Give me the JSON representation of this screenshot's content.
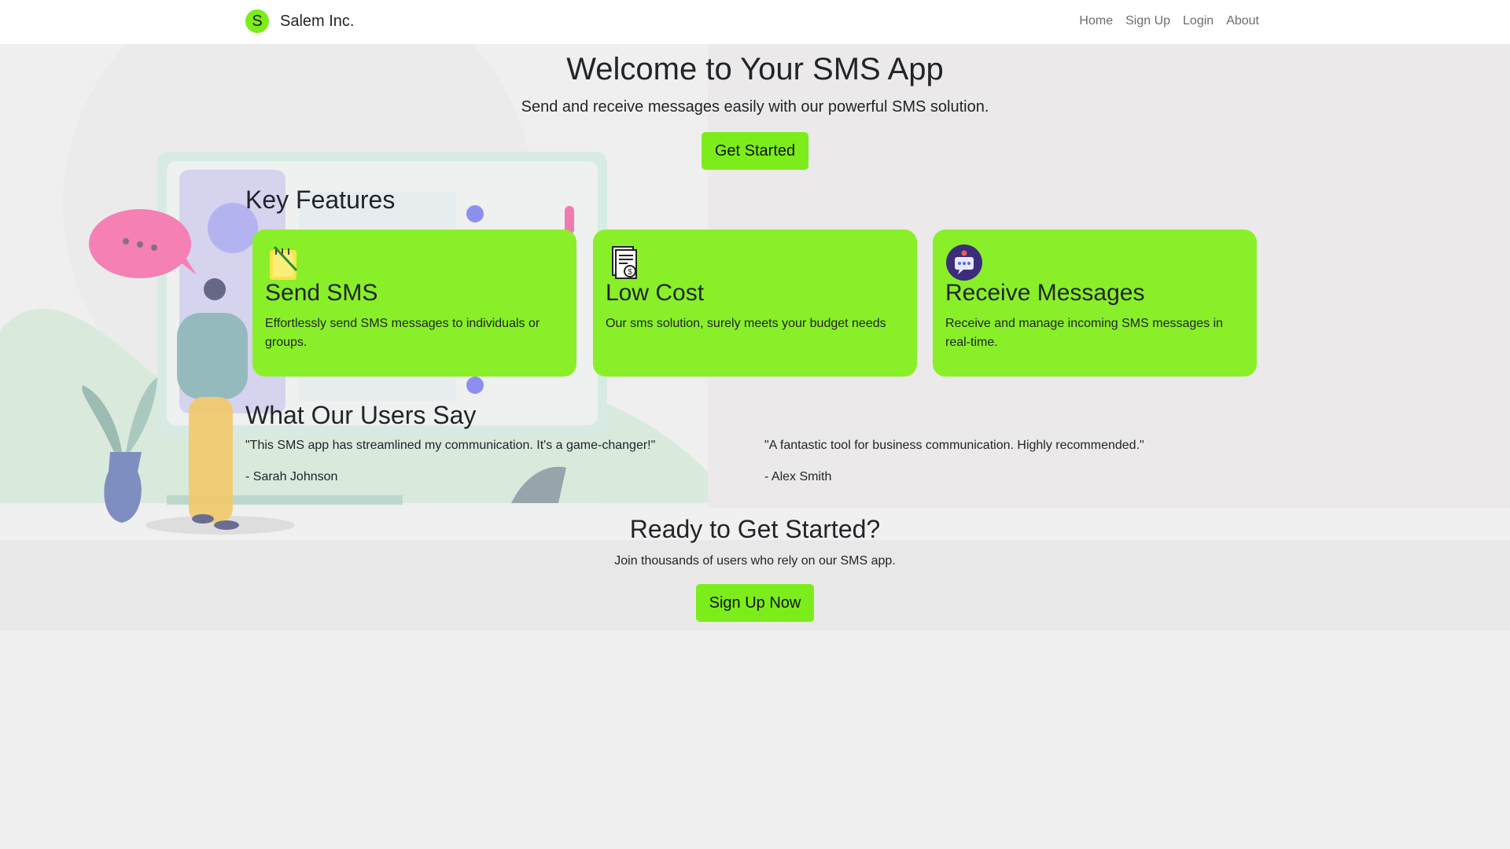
{
  "nav": {
    "logo_letter": "S",
    "brand": "Salem Inc.",
    "links": [
      "Home",
      "Sign Up",
      "Login",
      "About"
    ]
  },
  "hero": {
    "title": "Welcome to Your SMS App",
    "subtitle": "Send and receive messages easily with our powerful SMS solution.",
    "button": "Get Started"
  },
  "features": {
    "title": "Key Features",
    "cards": [
      {
        "icon": "notepad-icon",
        "title": "Send SMS",
        "desc": "Effortlessly send SMS messages to individuals or groups."
      },
      {
        "icon": "document-dollar-icon",
        "title": "Low Cost",
        "desc": "Our sms solution, surely meets your budget needs"
      },
      {
        "icon": "chat-notification-icon",
        "title": "Receive Messages",
        "desc": "Receive and manage incoming SMS messages in real-time."
      }
    ]
  },
  "testimonials": {
    "title": "What Our Users Say",
    "items": [
      {
        "quote": "\"This SMS app has streamlined my communication. It's a game-changer!\"",
        "author": "- Sarah Johnson"
      },
      {
        "quote": "\"A fantastic tool for business communication. Highly recommended.\"",
        "author": "- Alex Smith"
      }
    ]
  },
  "cta": {
    "title": "Ready to Get Started?",
    "subtitle": "Join thousands of users who rely on our SMS app.",
    "button": "Sign Up Now"
  },
  "colors": {
    "accent": "#7ced1a",
    "card": "#89ef29",
    "page_bg": "#f1f0f0"
  }
}
